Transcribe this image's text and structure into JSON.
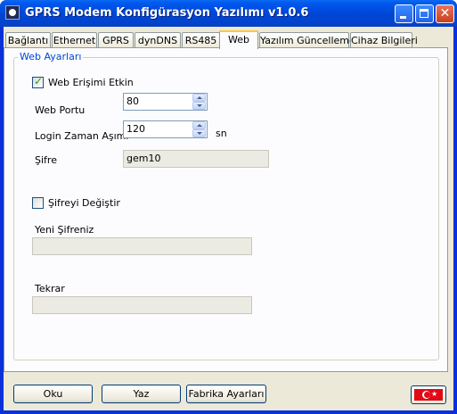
{
  "window": {
    "title": "GPRS Modem Konfigürasyon Yazılımı v1.0.6"
  },
  "tabs": [
    {
      "label": "Bağlantı"
    },
    {
      "label": "Ethernet"
    },
    {
      "label": "GPRS"
    },
    {
      "label": "dynDNS"
    },
    {
      "label": "RS485"
    },
    {
      "label": "Web",
      "active": true
    },
    {
      "label": "Yazılım Güncelleme"
    },
    {
      "label": "Cihaz Bilgileri"
    }
  ],
  "web": {
    "group_label": "Web Ayarları",
    "enable_label": "Web Erişimi Etkin",
    "enable_checked": true,
    "port_label": "Web Portu",
    "port_value": "80",
    "timeout_label": "Login Zaman Aşımı",
    "timeout_value": "120",
    "timeout_unit": "sn",
    "password_label": "Şifre",
    "password_value": "gem10",
    "change_label": "Şifreyi Değiştir",
    "change_checked": false,
    "new_password_label": "Yeni Şifreniz",
    "new_password_value": "",
    "repeat_label": "Tekrar",
    "repeat_value": ""
  },
  "buttons": {
    "read": "Oku",
    "write": "Yaz",
    "factory": "Fabrika Ayarları"
  },
  "colors": {
    "group_label": "#0046d5",
    "active_tab_accent": "#ffc83c",
    "flag_red": "#e30a17"
  }
}
